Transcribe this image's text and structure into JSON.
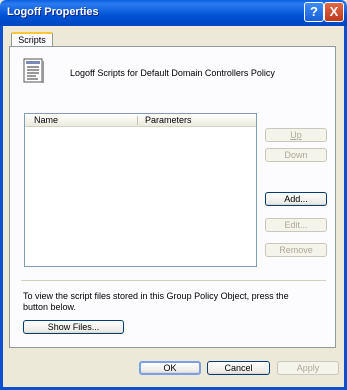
{
  "window": {
    "title": "Logoff Properties"
  },
  "titlebar": {
    "help_glyph": "?",
    "close_glyph": "X"
  },
  "tabs": [
    {
      "label": "Scripts"
    }
  ],
  "policy": {
    "title": "Logoff Scripts for Default Domain Controllers Policy",
    "icon": "script-document-icon"
  },
  "listview": {
    "columns": [
      "Name",
      "Parameters"
    ],
    "rows": []
  },
  "side_buttons": {
    "up": {
      "label": "Up",
      "enabled": false
    },
    "down": {
      "label": "Down",
      "enabled": false
    },
    "add": {
      "label": "Add...",
      "enabled": true
    },
    "edit": {
      "label": "Edit...",
      "enabled": false
    },
    "remove": {
      "label": "Remove",
      "enabled": false
    }
  },
  "info": {
    "text": "To view the script files stored in this Group Policy Object, press the button below."
  },
  "show_files": {
    "label": "Show Files..."
  },
  "footer": {
    "ok": "OK",
    "cancel": "Cancel",
    "apply": "Apply"
  },
  "colors": {
    "titlebar": "#0052D6",
    "dialog": "#ECE9D8",
    "tab_highlight": "#FFC83C"
  }
}
